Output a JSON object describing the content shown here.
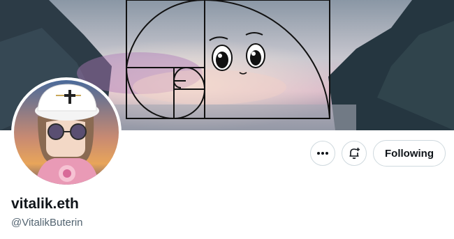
{
  "profile": {
    "display_name": "vitalik.eth",
    "handle": "@VitalikButerin"
  },
  "actions": {
    "more_icon": "more-horizontal-icon",
    "notify_icon": "bell-plus-icon",
    "follow_label": "Following"
  },
  "colors": {
    "text_primary": "#0f1419",
    "text_secondary": "#536471",
    "border": "#cfd9de"
  }
}
